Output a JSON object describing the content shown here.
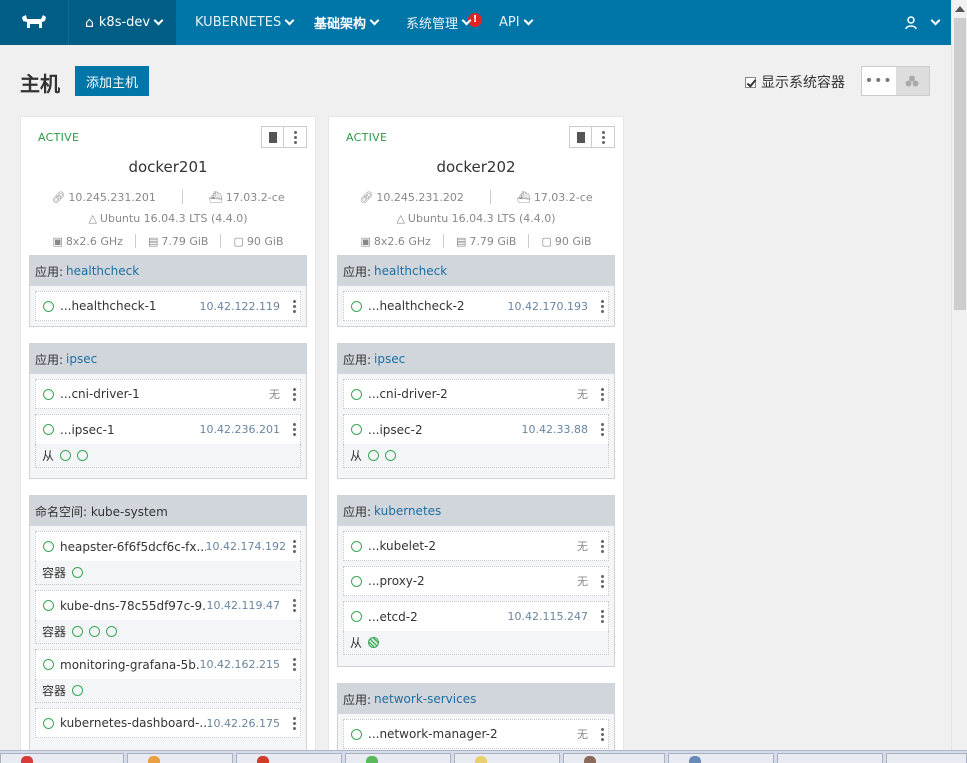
{
  "nav": {
    "env": "k8s-dev",
    "items": [
      {
        "label": "KUBERNETES",
        "bold": false
      },
      {
        "label": "基础架构",
        "bold": true
      },
      {
        "label": "系统管理",
        "bold": false
      },
      {
        "label": "API",
        "bold": false
      }
    ],
    "alert_badge": "!"
  },
  "header": {
    "title": "主机",
    "add_button": "添加主机",
    "show_system": "显示系统容器"
  },
  "hosts": [
    {
      "state": "ACTIVE",
      "name": "docker201",
      "ip": "10.245.231.201",
      "docker": "17.03.2-ce",
      "os": "Ubuntu 16.04.3 LTS (4.4.0)",
      "cpu": "8x2.6 GHz",
      "mem": "7.79 GiB",
      "disk": "90 GiB",
      "groups": [
        {
          "prefix": "应用:",
          "link": "healthcheck",
          "containers": [
            {
              "name": "...healthcheck-1",
              "ip": "10.42.122.119"
            }
          ]
        },
        {
          "prefix": "应用:",
          "link": "ipsec",
          "containers": [
            {
              "name": "...cni-driver-1",
              "ip": "无"
            },
            {
              "name": "...ipsec-1",
              "ip": "10.42.236.201"
            }
          ],
          "sidekick_label": "从"
        },
        {
          "prefix": "命名空间: kube-system",
          "link": "",
          "containers": [
            {
              "name": "heapster-6f6f5dcf6c-fx...",
              "ip": "10.42.174.192",
              "sub_label": "容器"
            },
            {
              "name": "kube-dns-78c55df97c-9...",
              "ip": "10.42.119.47",
              "sub_label": "容器"
            },
            {
              "name": "monitoring-grafana-5b...",
              "ip": "10.42.162.215",
              "sub_label": "容器"
            },
            {
              "name": "kubernetes-dashboard-...",
              "ip": "10.42.26.175"
            }
          ]
        }
      ]
    },
    {
      "state": "ACTIVE",
      "name": "docker202",
      "ip": "10.245.231.202",
      "docker": "17.03.2-ce",
      "os": "Ubuntu 16.04.3 LTS (4.4.0)",
      "cpu": "8x2.6 GHz",
      "mem": "7.79 GiB",
      "disk": "90 GiB",
      "groups": [
        {
          "prefix": "应用:",
          "link": "healthcheck",
          "containers": [
            {
              "name": "...healthcheck-2",
              "ip": "10.42.170.193"
            }
          ]
        },
        {
          "prefix": "应用:",
          "link": "ipsec",
          "containers": [
            {
              "name": "...cni-driver-2",
              "ip": "无"
            },
            {
              "name": "...ipsec-2",
              "ip": "10.42.33.88"
            }
          ],
          "sidekick_label": "从"
        },
        {
          "prefix": "应用:",
          "link": "kubernetes",
          "containers": [
            {
              "name": "...kubelet-2",
              "ip": "无"
            },
            {
              "name": "...proxy-2",
              "ip": "无"
            },
            {
              "name": "...etcd-2",
              "ip": "10.42.115.247"
            }
          ],
          "sidekick_label": "从"
        },
        {
          "prefix": "应用:",
          "link": "network-services",
          "containers": [
            {
              "name": "...network-manager-2",
              "ip": "无"
            }
          ]
        }
      ]
    }
  ],
  "colors": {
    "nav_bg": "#0075a8",
    "nav_dark": "#005e86",
    "active": "#2c9b46",
    "link": "#1d6ea3"
  }
}
